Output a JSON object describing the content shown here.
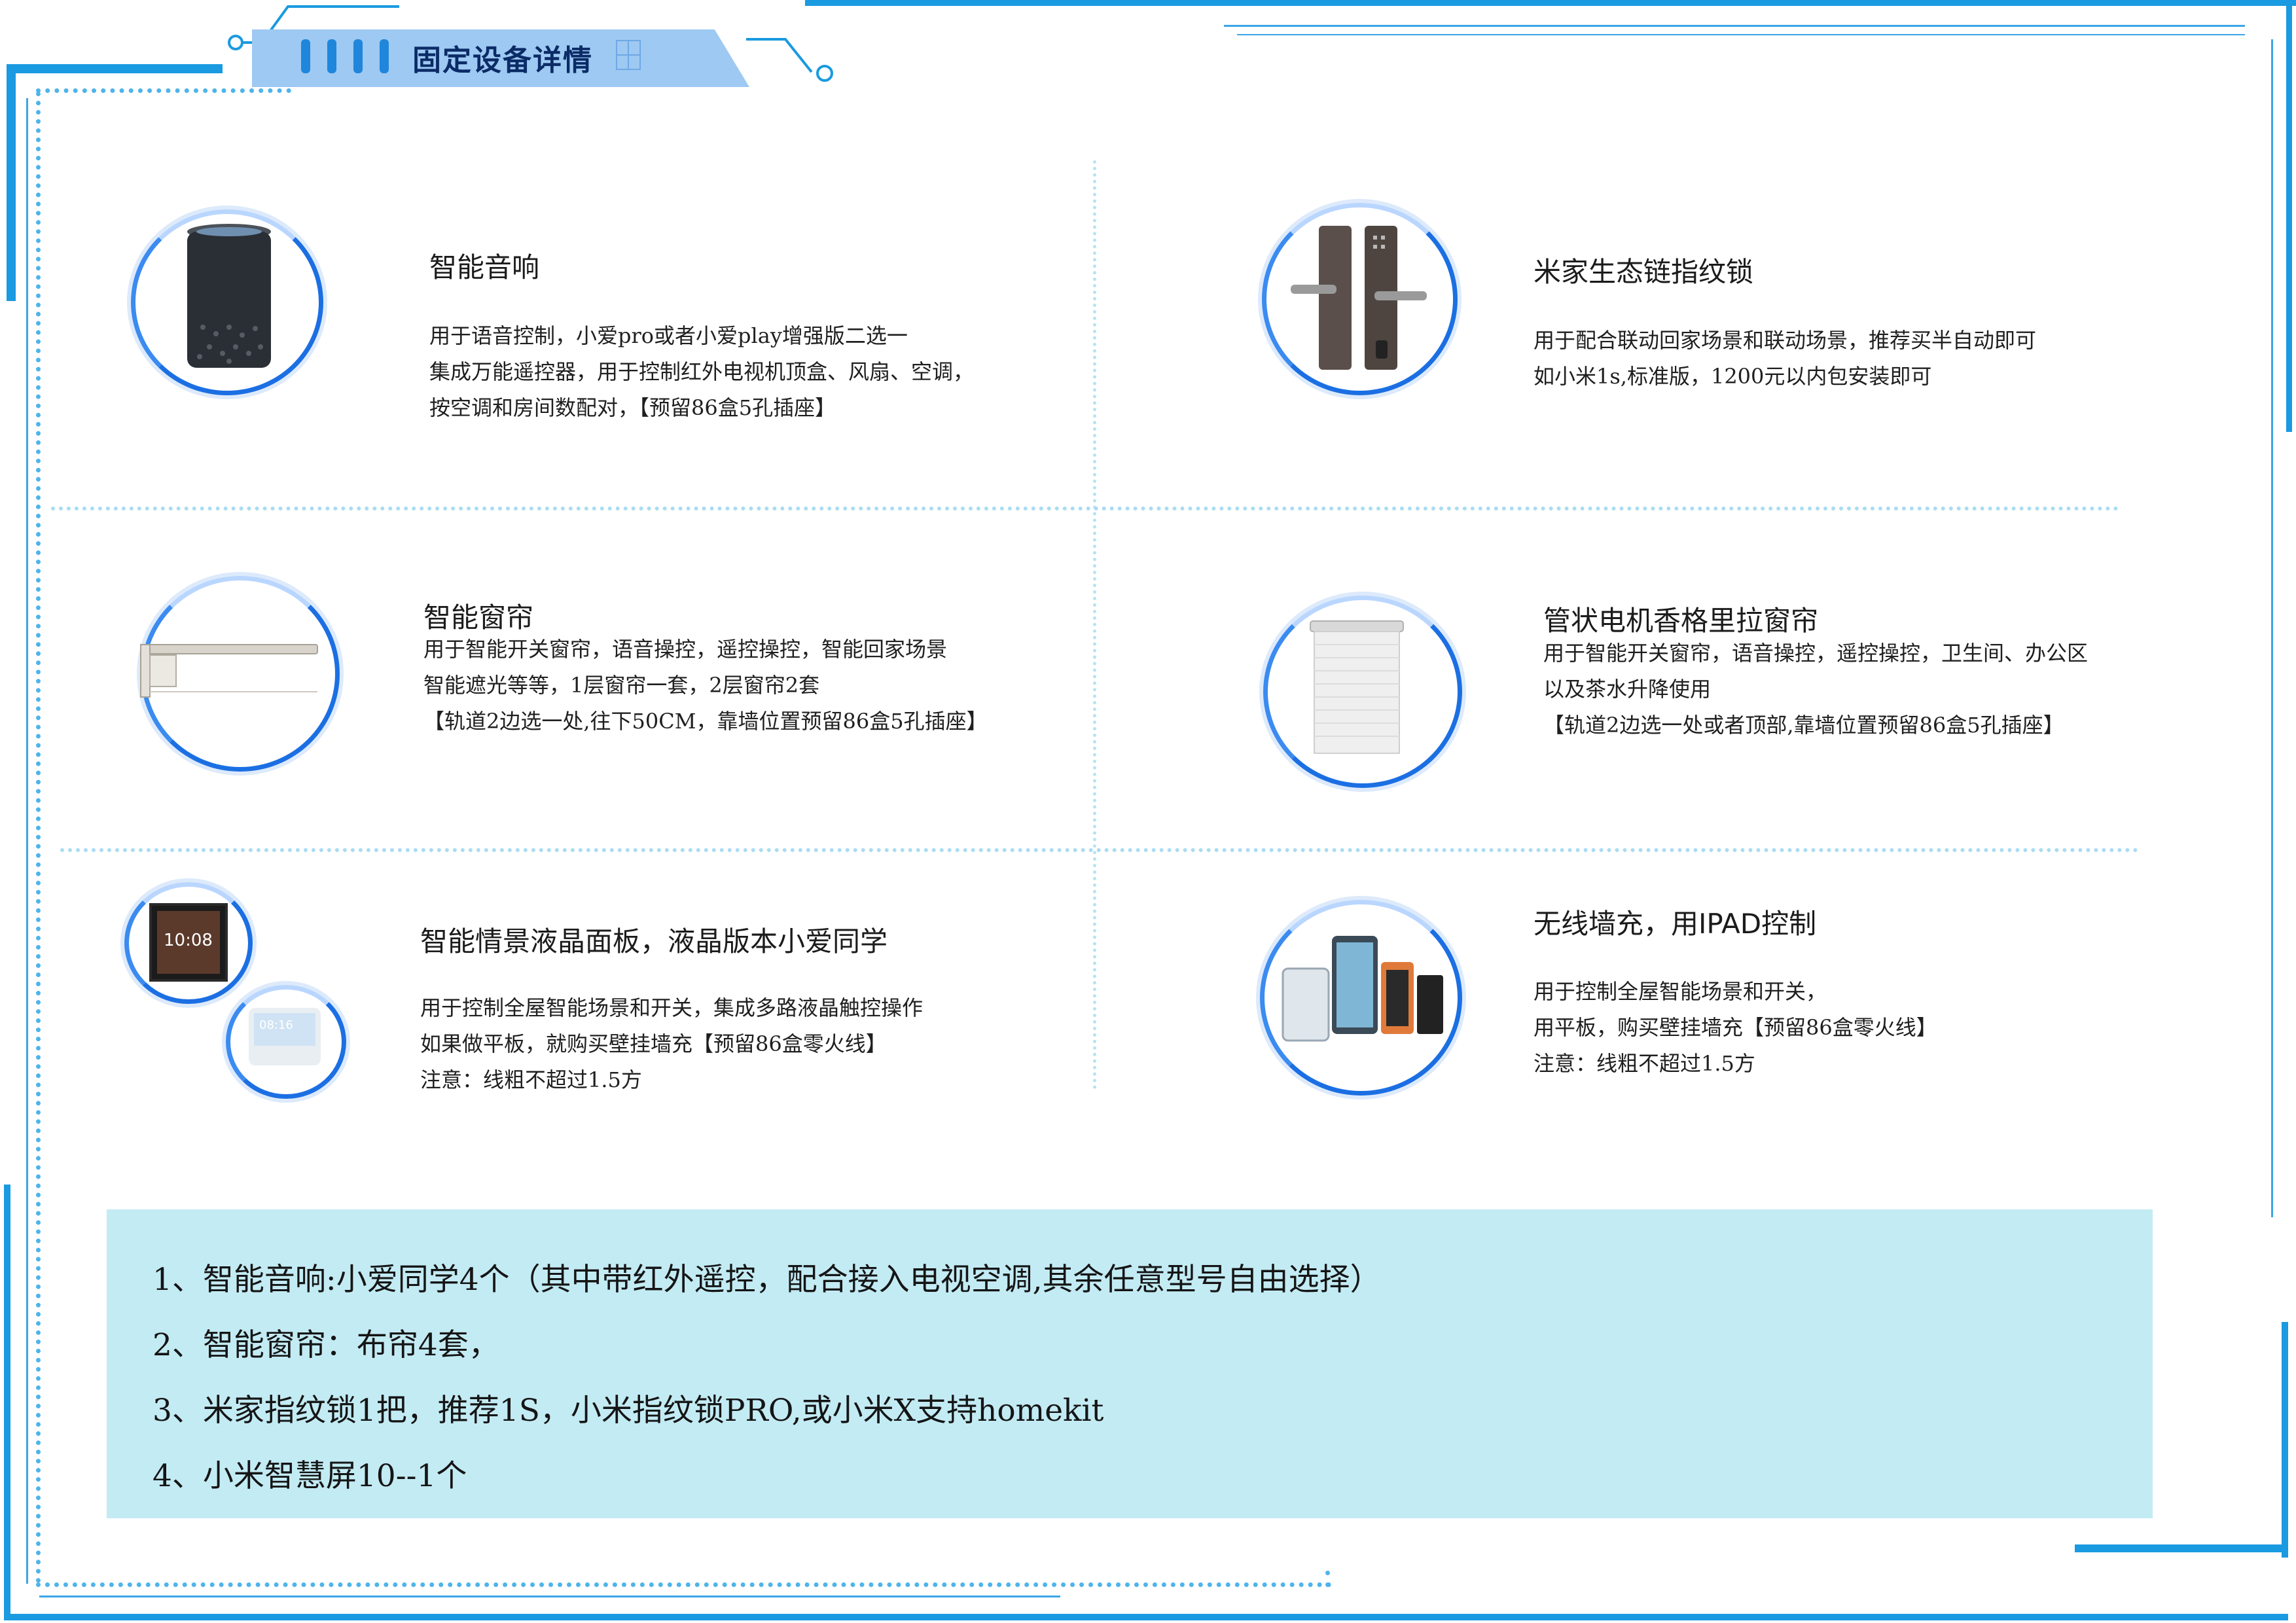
{
  "header": {
    "title": "固定设备详情"
  },
  "items": [
    {
      "title": "智能音响",
      "lines": [
        "用于语音控制，小爱pro或者小爱play增强版二选一",
        "集成万能遥控器，用于控制红外电视机顶盒、风扇、空调，",
        "按空调和房间数配对，【预留86盒5孔插座】"
      ]
    },
    {
      "title": "米家生态链指纹锁",
      "lines": [
        "用于配合联动回家场景和联动场景，推荐买半自动即可",
        "如小米1s,标准版，1200元以内包安装即可"
      ]
    },
    {
      "title": "智能窗帘",
      "lines": [
        "用于智能开关窗帘，语音操控，遥控操控，智能回家场景",
        "智能遮光等等，1层窗帘一套，2层窗帘2套",
        "【轨道2边选一处,往下50CM，靠墙位置预留86盒5孔插座】"
      ]
    },
    {
      "title": "管状电机香格里拉窗帘",
      "lines": [
        "用于智能开关窗帘，语音操控，遥控操控，卫生间、办公区",
        "以及茶水升降使用",
        "【轨道2边选一处或者顶部,靠墙位置预留86盒5孔插座】"
      ]
    },
    {
      "title": "智能情景液晶面板，液晶版本小爱同学",
      "lines": [
        "用于控制全屋智能场景和开关，集成多路液晶触控操作",
        "如果做平板，就购买壁挂墙充【预留86盒零火线】",
        "注意：线粗不超过1.5方"
      ],
      "screen_time": "10:08",
      "screen_time_2": "08:16"
    },
    {
      "title": "无线墙充，用IPAD控制",
      "lines": [
        "用于控制全屋智能场景和开关，",
        "用平板，购买壁挂墙充【预留86盒零火线】",
        "注意：线粗不超过1.5方"
      ]
    }
  ],
  "summary": [
    "1、智能音响:小爱同学4个（其中带红外遥控，配合接入电视空调,其余任意型号自由选择）",
    "2、智能窗帘：布帘4套，",
    "3、米家指纹锁1把，推荐1S，小米指纹锁PRO,或小米X支持homekit",
    "4、小米智慧屏10--1个"
  ],
  "colors": {
    "frame": "#1a9ae0",
    "tab": "#9ec9f2",
    "summary_bg": "#c3ebf4",
    "ring": "#1b6fe3"
  },
  "icons": [
    "smart-speaker-image",
    "fingerprint-lock-image",
    "curtain-track-image",
    "roller-blind-image",
    "lcd-panel-image",
    "wireless-charger-tablet-image"
  ]
}
